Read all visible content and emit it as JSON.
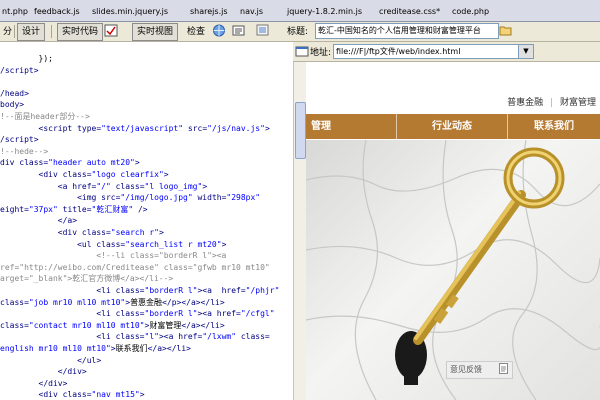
{
  "tabs": [
    {
      "label": "nt.php"
    },
    {
      "label": "feedback.js"
    },
    {
      "label": "slides.min.jquery.js"
    },
    {
      "label": "sharejs.js"
    },
    {
      "label": "nav.js"
    },
    {
      "label": "jquery-1.8.2.min.js"
    },
    {
      "label": "creditease.css*"
    },
    {
      "label": "code.php"
    }
  ],
  "toolbar": {
    "split_label": "分",
    "design_label": "设计",
    "live_code_label": "实时代码",
    "live_view_label": "实时视图",
    "inspect_label": "检查",
    "title_label": "标题:",
    "title_value": "乾汇-中国知名的个人信用管理和财富管理平台"
  },
  "address": {
    "label": "地址:",
    "value": "file:///F|/ftp文件/web/index.html"
  },
  "code_lines": [
    {
      "parts": [
        {
          "t": "        });",
          "c": "txt"
        }
      ]
    },
    {
      "parts": [
        {
          "t": "/script>",
          "c": "tag"
        }
      ]
    },
    {
      "parts": [
        {
          "t": "",
          "c": "txt"
        }
      ]
    },
    {
      "parts": [
        {
          "t": "/head>",
          "c": "tag"
        }
      ]
    },
    {
      "parts": [
        {
          "t": "body>",
          "c": "tag"
        }
      ]
    },
    {
      "parts": [
        {
          "t": "!--面是header部分-->",
          "c": "cmt"
        }
      ]
    },
    {
      "parts": [
        {
          "t": "        <script ",
          "c": "tag"
        },
        {
          "t": "type=",
          "c": "attr"
        },
        {
          "t": "\"text/javascript\"",
          "c": "str"
        },
        {
          "t": " src=",
          "c": "attr"
        },
        {
          "t": "\"/js/nav.js\"",
          "c": "str"
        },
        {
          "t": ">",
          "c": "tag"
        }
      ]
    },
    {
      "parts": [
        {
          "t": "/script>",
          "c": "tag"
        }
      ]
    },
    {
      "parts": [
        {
          "t": "!--hede-->",
          "c": "cmt"
        }
      ]
    },
    {
      "parts": [
        {
          "t": "div ",
          "c": "tag"
        },
        {
          "t": "class=",
          "c": "attr"
        },
        {
          "t": "\"header auto mt20\"",
          "c": "str"
        },
        {
          "t": ">",
          "c": "tag"
        }
      ]
    },
    {
      "parts": [
        {
          "t": "        <div ",
          "c": "tag"
        },
        {
          "t": "class=",
          "c": "attr"
        },
        {
          "t": "\"logo clearfix\"",
          "c": "str"
        },
        {
          "t": ">",
          "c": "tag"
        }
      ]
    },
    {
      "parts": [
        {
          "t": "            <a ",
          "c": "tag"
        },
        {
          "t": "href=",
          "c": "attr"
        },
        {
          "t": "\"/\"",
          "c": "str"
        },
        {
          "t": " class=",
          "c": "attr"
        },
        {
          "t": "\"l logo_img\"",
          "c": "str"
        },
        {
          "t": ">",
          "c": "tag"
        }
      ]
    },
    {
      "parts": [
        {
          "t": "                <img ",
          "c": "tag"
        },
        {
          "t": "src=",
          "c": "attr"
        },
        {
          "t": "\"/img/logo.jpg\"",
          "c": "str"
        },
        {
          "t": " width=",
          "c": "attr"
        },
        {
          "t": "\"298px\"",
          "c": "str"
        }
      ]
    },
    {
      "parts": [
        {
          "t": "eight=",
          "c": "attr"
        },
        {
          "t": "\"37px\"",
          "c": "str"
        },
        {
          "t": " title=",
          "c": "attr"
        },
        {
          "t": "\"乾汇财富\"",
          "c": "str"
        },
        {
          "t": " />",
          "c": "tag"
        }
      ]
    },
    {
      "parts": [
        {
          "t": "            </a>",
          "c": "tag"
        }
      ]
    },
    {
      "parts": [
        {
          "t": "            <div ",
          "c": "tag"
        },
        {
          "t": "class=",
          "c": "attr"
        },
        {
          "t": "\"search r\"",
          "c": "str"
        },
        {
          "t": ">",
          "c": "tag"
        }
      ]
    },
    {
      "parts": [
        {
          "t": "                <ul ",
          "c": "tag"
        },
        {
          "t": "class=",
          "c": "attr"
        },
        {
          "t": "\"search_list r mt20\"",
          "c": "str"
        },
        {
          "t": ">",
          "c": "tag"
        }
      ]
    },
    {
      "parts": [
        {
          "t": "                    <!--li class=\"borderR l\"><a",
          "c": "cmt"
        }
      ]
    },
    {
      "parts": [
        {
          "t": "ref=\"http://weibo.com/Creditease\" class=\"gfwb mr10 mt10\"",
          "c": "cmt"
        }
      ]
    },
    {
      "parts": [
        {
          "t": "arget=\"_blank\">乾汇官方微博</a></li-->",
          "c": "cmt"
        }
      ]
    },
    {
      "parts": [
        {
          "t": "                    <li ",
          "c": "tag"
        },
        {
          "t": "class=",
          "c": "attr"
        },
        {
          "t": "\"borderR l\"",
          "c": "str"
        },
        {
          "t": "><a  ",
          "c": "tag"
        },
        {
          "t": "href=",
          "c": "attr"
        },
        {
          "t": "\"/phjr\"",
          "c": "str"
        }
      ]
    },
    {
      "parts": [
        {
          "t": "class=",
          "c": "attr"
        },
        {
          "t": "\"job mr10 ml10 mt10\"",
          "c": "str"
        },
        {
          "t": ">",
          "c": "tag"
        },
        {
          "t": "普惠金融",
          "c": "txt"
        },
        {
          "t": "</p></a></li>",
          "c": "tag"
        }
      ]
    },
    {
      "parts": [
        {
          "t": "                    <li ",
          "c": "tag"
        },
        {
          "t": "class=",
          "c": "attr"
        },
        {
          "t": "\"borderR l\"",
          "c": "str"
        },
        {
          "t": "><a ",
          "c": "tag"
        },
        {
          "t": "href=",
          "c": "attr"
        },
        {
          "t": "\"/cfgl\"",
          "c": "str"
        }
      ]
    },
    {
      "parts": [
        {
          "t": "class=",
          "c": "attr"
        },
        {
          "t": "\"contact mr10 ml10 mt10\"",
          "c": "str"
        },
        {
          "t": ">",
          "c": "tag"
        },
        {
          "t": "财富管理",
          "c": "txt"
        },
        {
          "t": "</a></li>",
          "c": "tag"
        }
      ]
    },
    {
      "parts": [
        {
          "t": "                    <li ",
          "c": "tag"
        },
        {
          "t": "class=",
          "c": "attr"
        },
        {
          "t": "\"l\"",
          "c": "str"
        },
        {
          "t": "><a ",
          "c": "tag"
        },
        {
          "t": "href=",
          "c": "attr"
        },
        {
          "t": "\"/lxwm\"",
          "c": "str"
        },
        {
          "t": " class=",
          "c": "attr"
        }
      ]
    },
    {
      "parts": [
        {
          "t": "english mr10 ml10 mt10\"",
          "c": "str"
        },
        {
          "t": ">",
          "c": "tag"
        },
        {
          "t": "联系我们",
          "c": "txt"
        },
        {
          "t": "</a></li>",
          "c": "tag"
        }
      ]
    },
    {
      "parts": [
        {
          "t": "                </ul>",
          "c": "tag"
        }
      ]
    },
    {
      "parts": [
        {
          "t": "            </div>",
          "c": "tag"
        }
      ]
    },
    {
      "parts": [
        {
          "t": "        </div>",
          "c": "tag"
        }
      ]
    },
    {
      "parts": [
        {
          "t": "        <div ",
          "c": "tag"
        },
        {
          "t": "class=",
          "c": "attr"
        },
        {
          "t": "\"nav mt15\"",
          "c": "str"
        },
        {
          "t": ">",
          "c": "tag"
        }
      ]
    }
  ],
  "preview": {
    "top_links": [
      "普惠金融",
      "财富管理"
    ],
    "nav": [
      "管理",
      "行业动态",
      "联系我们"
    ],
    "feedback": "意见反馈"
  },
  "colors": {
    "nav_bg": "#b57a32",
    "code_tag": "#000080",
    "code_string": "#0000ff",
    "code_comment": "#888888"
  }
}
